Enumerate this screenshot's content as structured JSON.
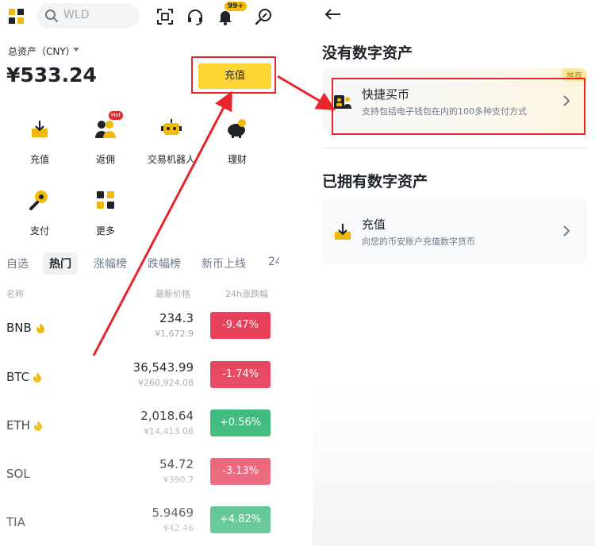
{
  "left": {
    "search_placeholder": "WLD",
    "notification_count": "99+",
    "asset_label": "总资产（CNY）",
    "asset_value": "¥533.24",
    "deposit_button": "充值",
    "quick_actions": [
      {
        "label": "充值",
        "icon": "deposit-tray-icon"
      },
      {
        "label": "返佣",
        "icon": "referral-people-icon",
        "badge": "Hot"
      },
      {
        "label": "交易机器人",
        "icon": "robot-icon"
      },
      {
        "label": "理财",
        "icon": "piggy-bank-icon"
      },
      {
        "label": "支付",
        "icon": "pay-icon"
      },
      {
        "label": "更多",
        "icon": "more-grid-icon"
      }
    ],
    "market_tabs": [
      "自选",
      "热门",
      "涨幅榜",
      "跌幅榜",
      "新币上线",
      "24"
    ],
    "active_tab_index": 1,
    "columns": {
      "name": "名称",
      "price": "最新价格",
      "change": "24h涨跌幅"
    },
    "coins": [
      {
        "symbol": "BNB",
        "price": "234.3",
        "cny": "¥1,672.9",
        "change": "-9.47%",
        "direction": "down",
        "flame": true
      },
      {
        "symbol": "BTC",
        "price": "36,543.99",
        "cny": "¥260,924.08",
        "change": "-1.74%",
        "direction": "down",
        "flame": true
      },
      {
        "symbol": "ETH",
        "price": "2,018.64",
        "cny": "¥14,413.08",
        "change": "+0.56%",
        "direction": "up",
        "flame": true
      },
      {
        "symbol": "SOL",
        "price": "54.72",
        "cny": "¥390.7",
        "change": "-3.13%",
        "direction": "down",
        "flame": false
      },
      {
        "symbol": "TIA",
        "price": "5.9469",
        "cny": "¥42.46",
        "change": "+4.82%",
        "direction": "up",
        "flame": false
      }
    ]
  },
  "right": {
    "no_assets_title": "没有数字资产",
    "buy_card": {
      "title": "快捷买币",
      "subtitle": "支持包括电子钱包在内的100多种支付方式",
      "tag": "推荐"
    },
    "have_assets_title": "已拥有数字资产",
    "deposit_card": {
      "title": "充值",
      "subtitle": "向您的币安账户充值数字货币"
    }
  },
  "colors": {
    "brand": "#fcd535",
    "down": "#e6405a",
    "up": "#24b36b",
    "highlight": "#e6262b"
  }
}
